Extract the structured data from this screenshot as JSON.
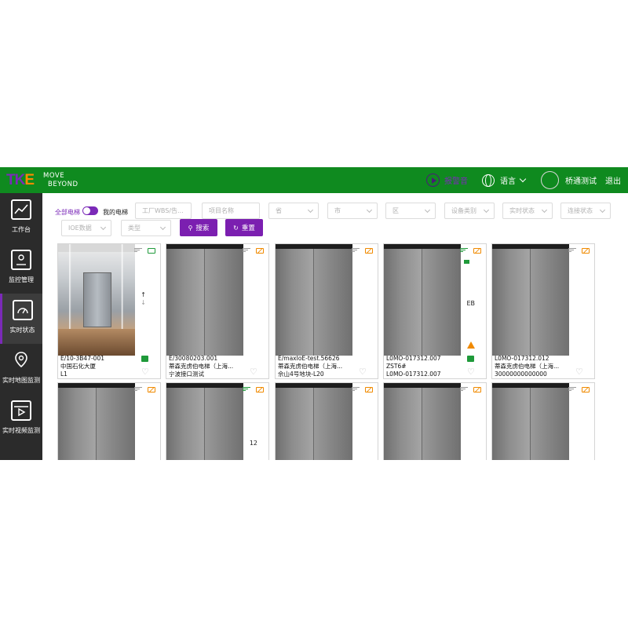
{
  "brand": {
    "logo_mark": "TKE",
    "tagline_line1": "MOVE",
    "tagline_line2": "BEYOND"
  },
  "topbar": {
    "alarm_label": "报警音",
    "language_label": "语言",
    "user_name": "桥通测试",
    "logout_label": "退出"
  },
  "sidebar": {
    "items": [
      {
        "label": "工作台",
        "icon": "chart-line-icon"
      },
      {
        "label": "监控管理",
        "icon": "person-badge-icon"
      },
      {
        "label": "实时状态",
        "icon": "dashboard-icon",
        "active": true
      },
      {
        "label": "实时地图监测",
        "icon": "map-pin-icon"
      },
      {
        "label": "实时视频监测",
        "icon": "video-play-icon"
      }
    ]
  },
  "filters": {
    "switch_all": "全部电梯",
    "switch_mine": "我的电梯",
    "wbs_placeholder": "工厂WBS/告...",
    "project_placeholder": "项目名称",
    "province_placeholder": "省",
    "city_placeholder": "市",
    "district_placeholder": "区",
    "device_type_placeholder": "设备类别",
    "realtime_status_placeholder": "实时状态",
    "connection_status_placeholder": "连接状态",
    "ioe_placeholder": "IOE数据",
    "type_placeholder": "类型",
    "search_label": "搜索",
    "reset_label": "重置"
  },
  "cards": [
    {
      "code": "E/10-3B47-001",
      "name": "中国石化大厦",
      "sub": "L1",
      "cabin": true,
      "tag": "green",
      "signal": "gray"
    },
    {
      "code": "E/30080203.001",
      "name": "蒂森克虏伯电梯（上海...",
      "sub": "宁波接口测试",
      "tag": "orange",
      "signal": "gray"
    },
    {
      "code": "E/maxIoE-test.56626",
      "name": "蒂森克虏伯电梯（上海...",
      "sub": "佘山4号地块-L20",
      "tag": "orange",
      "signal": "gray"
    },
    {
      "code": "L0MO-017312.007",
      "name": "ZST6#",
      "sub": "L0MO-017312.007",
      "tag": "orange",
      "signal": "green",
      "floor": "EB"
    },
    {
      "code": "L0MO-017312.012",
      "name": "蒂森克虏伯电梯（上海...",
      "sub": "30000000000000",
      "tag": "orange",
      "signal": "gray"
    },
    {
      "tag": "orange",
      "signal": "gray"
    },
    {
      "tag": "orange",
      "signal": "green",
      "floor": "12"
    },
    {
      "tag": "orange",
      "signal": "gray"
    },
    {
      "tag": "orange",
      "signal": "gray"
    },
    {
      "tag": "orange",
      "signal": "gray"
    }
  ],
  "colors": {
    "topbar": "#0f8a1f",
    "accent": "#7b1fb0",
    "sidebar": "#2b2b2b",
    "ok": "#1f9a3a",
    "warn": "#f08a00"
  }
}
